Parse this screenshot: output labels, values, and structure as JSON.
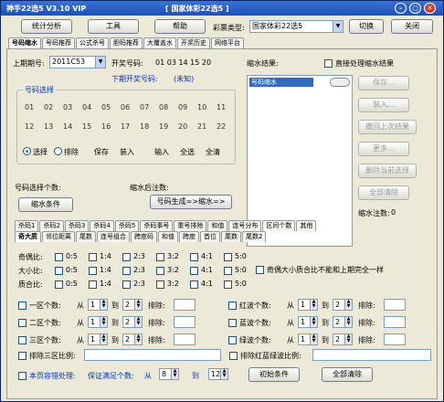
{
  "window": {
    "title": "神手22选5 V3.10 VIP",
    "subtitle": "[ 国家体彩22选5 ]"
  },
  "toolbar": {
    "stats_label": "统计分析",
    "tools_label": "工具",
    "help_label": "帮助",
    "lottery_type_label": "彩票类型:",
    "lottery_type_value": "国家体彩22选5",
    "switch_label": "切换",
    "close_label": "关闭"
  },
  "main_tabs": [
    "号码缩水",
    "号码推荐",
    "公式杀号",
    "胆码推荐",
    "大覆盖水",
    "开奖历史",
    "网络平台"
  ],
  "draw": {
    "period_label": "上期期号:",
    "period_value": "2011C53",
    "open_label": "开奖号码:",
    "open_value": "01 03 14 15 20",
    "next_label": "下期开奖号码:",
    "next_value": "(未知)"
  },
  "number_select": {
    "group_title": "号码选择",
    "row1": [
      "01",
      "02",
      "03",
      "04",
      "05",
      "06",
      "07",
      "08",
      "09",
      "10",
      "11"
    ],
    "row2": [
      "12",
      "13",
      "14",
      "15",
      "16",
      "17",
      "18",
      "19",
      "20",
      "21",
      "22"
    ],
    "mode_select": "选择",
    "mode_exclude": "排除",
    "save_label": "保存",
    "load_label": "装入",
    "input_label": "输入",
    "select_all_label": "全选",
    "clear_label": "全清"
  },
  "results": {
    "title": "缩水结果:",
    "direct_label": "直接处理缩水结果",
    "item": "号码缩水",
    "save_btn": "保存...",
    "load_btn": "装入...",
    "restore_btn": "撤回上次结果",
    "more_btn": "更多...",
    "delete_btn": "删除当前选择",
    "clear_btn": "全部清除",
    "note_count_label": "缩水注数:",
    "note_count_value": "0"
  },
  "counts": {
    "select_count_label": "号码选择个数:",
    "after_count_label": "缩水后注数:",
    "shrink_cond_label": "缩水条件",
    "generate_label": "号码生成=>缩水=>"
  },
  "cond_tabs_row1": [
    "杀码1",
    "杀码2",
    "杀码3",
    "杀码4",
    "杀码5",
    "杀码事号",
    "重号排除",
    "和值",
    "连号分布",
    "区间个数",
    "其他"
  ],
  "cond_tabs_row2": [
    "奇大质",
    "邻位距离",
    "尾数",
    "连号组合",
    "跨度码",
    "和值",
    "跨度",
    "首位",
    "尾数",
    "尾数2"
  ],
  "ratio_rows": [
    {
      "label": "奇偶比:",
      "options": [
        "0:5",
        "1:4",
        "2:3",
        "3:2",
        "4:1",
        "5:0"
      ]
    },
    {
      "label": "大小比:",
      "options": [
        "0:5",
        "1:4",
        "2:3",
        "3:2",
        "4:1",
        "5:0"
      ]
    },
    {
      "label": "质合比:",
      "options": [
        "0:5",
        "1:4",
        "2:3",
        "3:2",
        "4:1",
        "5:0"
      ]
    }
  ],
  "same_rule_label": "奇偶大小质合比不能和上期完全一样",
  "zone_rows": [
    {
      "label": "一区个数:",
      "from": "从",
      "from_val": "1",
      "to": "到",
      "to_val": "2",
      "exclude": "排除:"
    },
    {
      "label": "二区个数:",
      "from": "从",
      "from_val": "1",
      "to": "到",
      "to_val": "2",
      "exclude": "排除:"
    },
    {
      "label": "三区个数:",
      "from": "从",
      "from_val": "1",
      "to": "到",
      "to_val": "2",
      "exclude": "排除:"
    }
  ],
  "color_rows": [
    {
      "label": "红波个数:",
      "from": "从",
      "from_val": "1",
      "to": "到",
      "to_val": "2",
      "exclude": "排除:"
    },
    {
      "label": "蓝波个数:",
      "from": "从",
      "from_val": "1",
      "to": "到",
      "to_val": "2",
      "exclude": "排除:"
    },
    {
      "label": "绿波个数:",
      "from": "从",
      "from_val": "1",
      "to": "到",
      "to_val": "2",
      "exclude": "排除:"
    }
  ],
  "exclude_zone_ratio": "排除三区比例:",
  "exclude_color_ratio": "排除红蓝绿波比例:",
  "bottom": {
    "fault_label": "本页容错处理:",
    "fault_desc": "保证满足个数:",
    "from": "从",
    "from_val": "8",
    "to": "到",
    "to_val": "12",
    "reset_label": "初始条件",
    "clear_all_label": "全部清除"
  }
}
